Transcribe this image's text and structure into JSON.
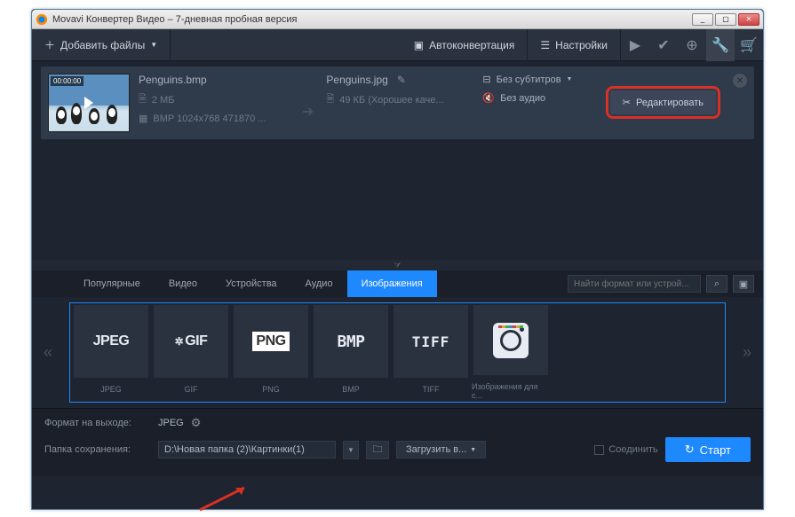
{
  "window": {
    "title": "Movavi Конвертер Видео – 7-дневная пробная версия"
  },
  "toolbar": {
    "add_files": "Добавить файлы",
    "autoconvert": "Автоконвертация",
    "settings": "Настройки"
  },
  "file": {
    "input_name": "Penguins.bmp",
    "input_size": "2 МБ",
    "input_dims": "BMP 1024x768 471870 ...",
    "timestamp": "00:00:00",
    "output_name": "Penguins.jpg",
    "output_size": "49 КБ (Хорошее каче...",
    "subtitles": "Без субтитров",
    "audio": "Без аудио",
    "edit_button": "Редактировать"
  },
  "tabs": {
    "popular": "Популярные",
    "video": "Видео",
    "devices": "Устройства",
    "audio": "Аудио",
    "images": "Изображения"
  },
  "search": {
    "placeholder": "Найти формат или устрой..."
  },
  "formats": {
    "jpeg": {
      "logo": "JPEG",
      "label": "JPEG"
    },
    "gif": {
      "logo": "GIF",
      "label": "GIF"
    },
    "png": {
      "logo": "PNG",
      "label": "PNG"
    },
    "bmp": {
      "logo": "BMP",
      "label": "BMP"
    },
    "tiff": {
      "logo": "TIFF",
      "label": "TIFF"
    },
    "instagram": {
      "label": "Изображения для с..."
    }
  },
  "bottom": {
    "output_format_label": "Формат на выходе:",
    "output_format_value": "JPEG",
    "save_folder_label": "Папка сохранения:",
    "save_folder_value": "D:\\Новая папка (2)\\Картинки(1)",
    "upload": "Загрузить в...",
    "merge": "Соединить",
    "start": "Старт"
  },
  "colors": {
    "accent": "#1e88ff",
    "highlight": "#d93025"
  }
}
